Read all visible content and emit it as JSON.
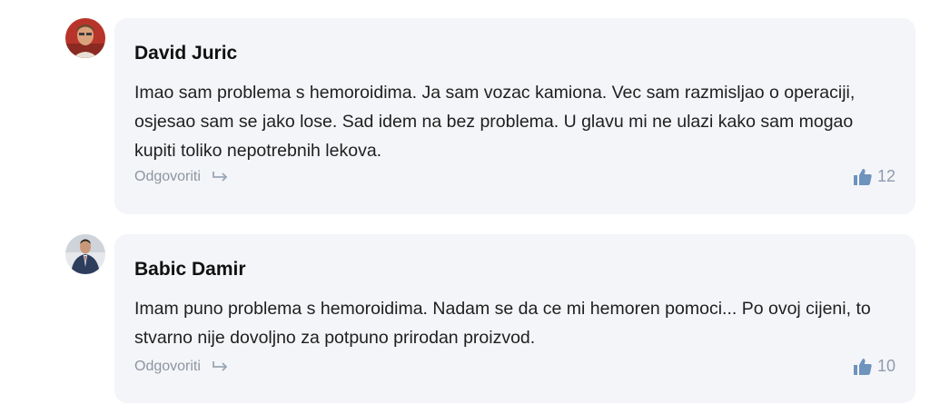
{
  "comments": [
    {
      "author": "David Juric",
      "text": "Imao sam problema s hemoroidima. Ja sam vozac kamiona. Vec sam razmisljao o operaciji, osjesao sam se jako lose. Sad idem na bez problema. U glavu mi ne ulazi kako sam mogao kupiti toliko nepotrebnih lekova.",
      "reply_label": "Odgovoriti",
      "likes": "12"
    },
    {
      "author": "Babic Damir",
      "text": "Imam puno problema s hemoroidima. Nadam se da ce mi hemoren pomoci... Po ovoj cijeni, to stvarno nije dovoljno za potpuno prirodan proizvod.",
      "reply_label": "Odgovoriti",
      "likes": "10"
    }
  ],
  "icons": {
    "reply": "reply-arrow-icon",
    "like": "thumbs-up-icon"
  },
  "colors": {
    "card_background": "#f4f5f8",
    "muted_text": "#8d95a1",
    "like_icon": "#6e93bd"
  }
}
